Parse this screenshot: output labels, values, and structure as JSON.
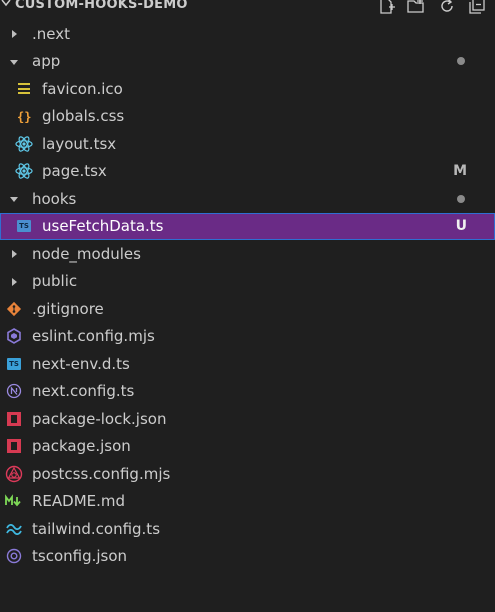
{
  "explorer": {
    "title": "CUSTOM-HOOKS-DEMO",
    "toolbar": [
      "new-file-icon",
      "new-folder-icon",
      "refresh-icon",
      "collapse-all-icon"
    ]
  },
  "tree": [
    {
      "label": ".next",
      "type": "folder",
      "expanded": false,
      "depth": 0,
      "icon": "chevron-right-icon"
    },
    {
      "label": "app",
      "type": "folder",
      "expanded": true,
      "depth": 0,
      "icon": "chevron-down-icon",
      "status": "dot"
    },
    {
      "label": "favicon.ico",
      "type": "file",
      "depth": 1,
      "icon": "favicon-icon"
    },
    {
      "label": "globals.css",
      "type": "file",
      "depth": 1,
      "icon": "css-icon"
    },
    {
      "label": "layout.tsx",
      "type": "file",
      "depth": 1,
      "icon": "react-icon"
    },
    {
      "label": "page.tsx",
      "type": "file",
      "depth": 1,
      "icon": "react-icon",
      "status": "M"
    },
    {
      "label": "hooks",
      "type": "folder",
      "expanded": true,
      "depth": 0,
      "icon": "chevron-down-icon",
      "status": "dot"
    },
    {
      "label": "useFetchData.ts",
      "type": "file",
      "depth": 1,
      "icon": "typescript-icon",
      "status": "U",
      "selected": true
    },
    {
      "label": "node_modules",
      "type": "folder",
      "expanded": false,
      "depth": 0,
      "icon": "chevron-right-icon"
    },
    {
      "label": "public",
      "type": "folder",
      "expanded": false,
      "depth": 0,
      "icon": "chevron-right-icon"
    },
    {
      "label": ".gitignore",
      "type": "file",
      "depth": 0,
      "icon": "git-icon"
    },
    {
      "label": "eslint.config.mjs",
      "type": "file",
      "depth": 0,
      "icon": "eslint-icon"
    },
    {
      "label": "next-env.d.ts",
      "type": "file",
      "depth": 0,
      "icon": "typescript-def-icon"
    },
    {
      "label": "next.config.ts",
      "type": "file",
      "depth": 0,
      "icon": "nextjs-icon"
    },
    {
      "label": "package-lock.json",
      "type": "file",
      "depth": 0,
      "icon": "npm-icon"
    },
    {
      "label": "package.json",
      "type": "file",
      "depth": 0,
      "icon": "npm-icon"
    },
    {
      "label": "postcss.config.mjs",
      "type": "file",
      "depth": 0,
      "icon": "postcss-icon"
    },
    {
      "label": "README.md",
      "type": "file",
      "depth": 0,
      "icon": "markdown-icon"
    },
    {
      "label": "tailwind.config.ts",
      "type": "file",
      "depth": 0,
      "icon": "tailwind-icon"
    },
    {
      "label": "tsconfig.json",
      "type": "file",
      "depth": 0,
      "icon": "tsconfig-icon"
    }
  ],
  "colors": {
    "background": "#1f1f1f",
    "selected_background": "#6a2b86",
    "selected_border": "#2f6fd1",
    "text": "#cccccc"
  }
}
